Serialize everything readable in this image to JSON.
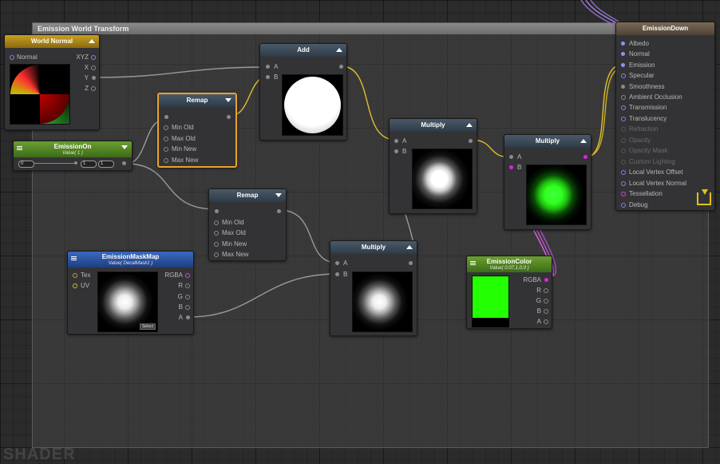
{
  "group": {
    "title": "Emission World Transform"
  },
  "watermark": "SHADER",
  "nodes": {
    "world_normal": {
      "title": "World Normal",
      "outputs": [
        "Normal",
        "XYZ",
        "X",
        "Y",
        "Z"
      ]
    },
    "emission_on": {
      "title": "EmissionOn",
      "subtitle": "Value( 1 )",
      "min": "0",
      "value": "1",
      "max": "1"
    },
    "remap1": {
      "title": "Remap",
      "inputs": [
        "Min Old",
        "Max Old",
        "Min New",
        "Max New"
      ]
    },
    "add": {
      "title": "Add",
      "inputs": [
        "A",
        "B"
      ]
    },
    "remap2": {
      "title": "Remap",
      "inputs": [
        "Min Old",
        "Max Old",
        "Min New",
        "Max New"
      ]
    },
    "multiply1": {
      "title": "Multiply",
      "inputs": [
        "A",
        "B"
      ]
    },
    "multiply2": {
      "title": "Multiply",
      "inputs": [
        "A",
        "B"
      ]
    },
    "multiply3": {
      "title": "Multiply",
      "inputs": [
        "A",
        "B"
      ]
    },
    "mask_map": {
      "title": "EmissionMaskMap",
      "subtitle": "Value( DecalMask1 )",
      "inputs": [
        "Tex",
        "UV"
      ],
      "outputs": [
        "RGBA",
        "R",
        "G",
        "B",
        "A"
      ],
      "select": "Select"
    },
    "emission_color": {
      "title": "EmissionColor",
      "subtitle": "Value( 0.07,1,0,0 )",
      "outputs": [
        "RGBA",
        "R",
        "G",
        "B",
        "A"
      ],
      "color": "#22ff00"
    },
    "emission_down": {
      "title": "EmissionDown",
      "inputs": [
        "Albedo",
        "Normal",
        "Emission",
        "Specular",
        "Smoothness",
        "Ambient Occlusion",
        "Transmission",
        "Translucency",
        "Refraction",
        "Opacity",
        "Opacity Mask",
        "Custom Lighting",
        "Local Vertex Offset",
        "Local Vertex Normal",
        "Tessellation",
        "Debug"
      ]
    }
  },
  "colors": {
    "selected": "#e8a428",
    "wire_yellow": "#e0c030",
    "wire_gray": "#9a9a9a",
    "wire_magenta": "#e060e0",
    "wire_purple": "#8a70d0"
  }
}
